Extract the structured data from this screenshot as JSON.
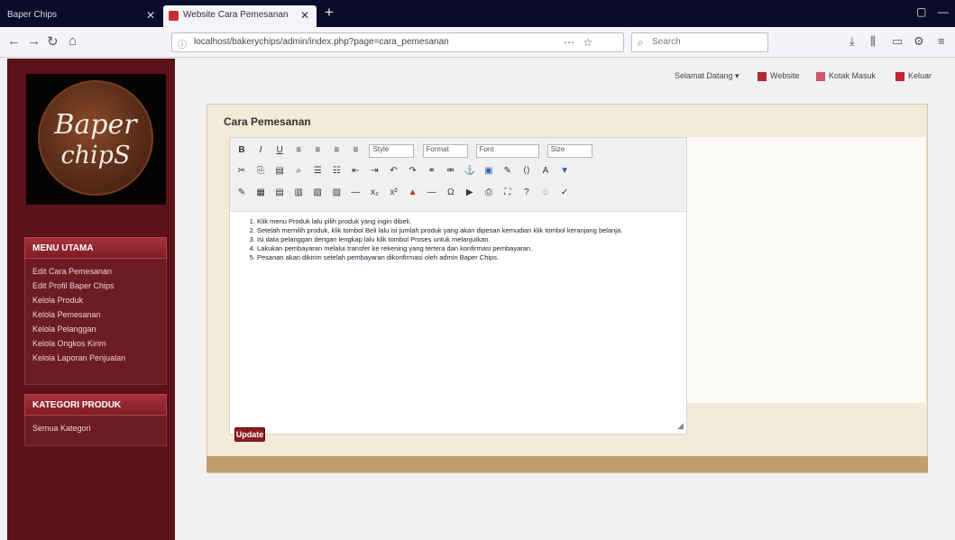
{
  "browser": {
    "tabs": [
      {
        "label": "Baper Chips"
      },
      {
        "label": "Website Cara Pemesanan"
      }
    ],
    "new_tab": "+",
    "url": "localhost/bakerychips/admin/index.php?page=cara_pemesanan",
    "search_placeholder": "Search"
  },
  "header": {
    "user_label": "Selamat Datang",
    "home_label": "Website",
    "inbox_label": "Kotak Masuk",
    "logout_label": "Keluar"
  },
  "sidebar": {
    "logo": {
      "line1": "Baper",
      "line2": "chipS"
    },
    "menu_title": "MENU UTAMA",
    "menu_items": [
      "Edit Cara Pemesanan",
      "Edit Profil Baper Chips",
      "Kelola Produk",
      "Kelola Pemesanan",
      "Kelola Pelanggan",
      "Kelola Ongkos Kirim",
      "Kelola Laporan Penjualan"
    ],
    "secondary_title": "KATEGORI PRODUK",
    "secondary_items": [
      "Semua Kategori"
    ]
  },
  "panel": {
    "title": "Cara Pemesanan",
    "submit_label": "Update"
  },
  "editor": {
    "selects": [
      "Style",
      "Format",
      "Font",
      "Size"
    ],
    "content": [
      "Klik menu Produk lalu pilih produk yang ingin dibeli.",
      "Setelah memilih produk, klik tombol Beli lalu isi jumlah produk yang akan dipesan kemudian klik tombol keranjang belanja.",
      "Isi data pelanggan dengan lengkap lalu klik tombol Proses untuk melanjutkan.",
      "Lakukan pembayaran melalui transfer ke rekening yang tertera dan konfirmasi pembayaran.",
      "Pesanan akan dikirim setelah pembayaran dikonfirmasi oleh admin Baper Chips."
    ]
  }
}
